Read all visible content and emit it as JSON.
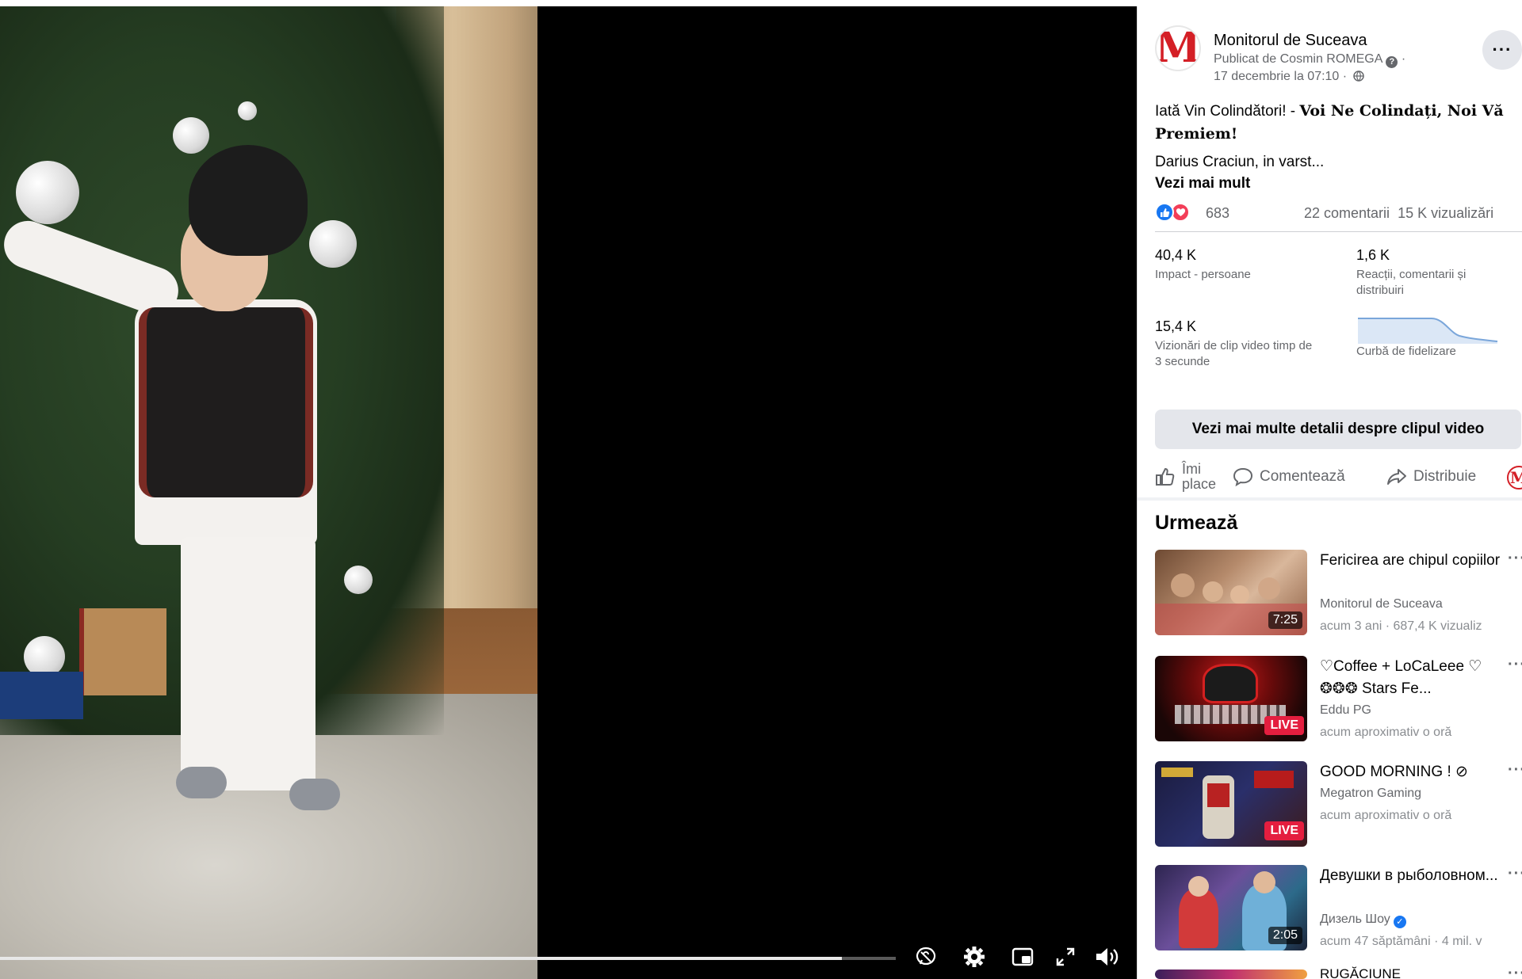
{
  "video": {
    "progress": 0.94
  },
  "post": {
    "page_name": "Monitorul de Suceava",
    "avatar_letter": "M",
    "published_by": "Publicat de Cosmin ROMEGA",
    "info_glyph": "?",
    "date": "17 decembrie la 07:10 ·",
    "text_plain": "Iată Vin Colindători! - ",
    "text_bold": "Voi Ne Colindați, Noi Vă Premiem!",
    "excerpt": "Darius Craciun, in varst...",
    "see_more": "Vezi mai mult",
    "reaction_count": "683",
    "comments": "22 comentarii",
    "views": "15 K vizualizări"
  },
  "insights": {
    "reach_value": "40,4 K",
    "reach_label": "Impact - persoane",
    "engagement_value": "1,6 K",
    "engagement_label": "Reacții, comentarii și distribuiri",
    "views3s_value": "15,4 K",
    "views3s_label": "Vizionări de clip video timp de 3 secunde",
    "retention_label": "Curbă de fidelizare",
    "details_button": "Vezi mai multe detalii despre clipul video"
  },
  "actions": {
    "like": "Îmi place",
    "comment": "Comentează",
    "share": "Distribuie"
  },
  "up_next": {
    "title": "Urmează",
    "items": [
      {
        "title": "Fericirea are chipul copiilor",
        "channel": "Monitorul de Suceava",
        "meta": "acum 3 ani · 687,4 K vizualiz",
        "badge": "7:25",
        "badge_type": "duration"
      },
      {
        "title": "♡Coffee + LoCaLeee ♡ ❂❂❂ Stars Fe...",
        "channel": "Eddu PG",
        "meta": "acum aproximativ o oră",
        "badge": "LIVE",
        "badge_type": "live"
      },
      {
        "title": "GOOD MORNING ! ⊘",
        "channel": "Megatron Gaming",
        "meta": "acum aproximativ o oră",
        "badge": "LIVE",
        "badge_type": "live"
      },
      {
        "title": "Девушки в рыболовном...",
        "channel": "Дизель Шоу",
        "meta": "acum 47 săptămâni · 4 mil. v",
        "badge": "2:05",
        "badge_type": "duration"
      }
    ],
    "truncated_title": "RUGĂCIUNE"
  },
  "colors": {
    "accent_blue": "#1877f2",
    "brand_red": "#d41f26",
    "live_red": "#e41e3f"
  }
}
